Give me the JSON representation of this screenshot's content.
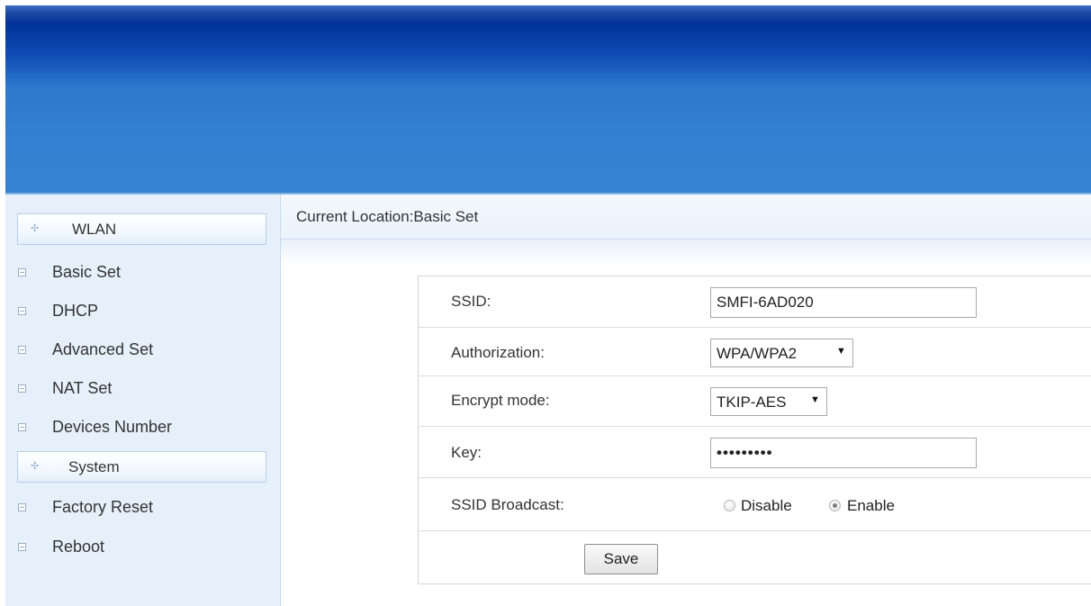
{
  "sidebar": {
    "groups": [
      {
        "label": "WLAN",
        "icon": "expand-icon"
      },
      {
        "label": "System",
        "icon": "expand-icon"
      }
    ],
    "wlan_items": [
      {
        "label": "Basic Set"
      },
      {
        "label": "DHCP"
      },
      {
        "label": "Advanced Set"
      },
      {
        "label": "NAT Set"
      },
      {
        "label": "Devices Number"
      }
    ],
    "system_items": [
      {
        "label": "Factory Reset"
      },
      {
        "label": "Reboot"
      }
    ]
  },
  "location": {
    "text": "Current Location:Basic Set"
  },
  "form": {
    "ssid": {
      "label": "SSID:",
      "value": "SMFI-6AD020"
    },
    "authorization": {
      "label": "Authorization:",
      "value": "WPA/WPA2"
    },
    "encrypt_mode": {
      "label": "Encrypt mode:",
      "value": "TKIP-AES"
    },
    "key": {
      "label": "Key:",
      "value": "•••••••••"
    },
    "ssid_broadcast": {
      "label": "SSID Broadcast:",
      "options": [
        {
          "label": "Disable",
          "checked": false
        },
        {
          "label": "Enable",
          "checked": true
        }
      ]
    },
    "save_label": "Save"
  },
  "colors": {
    "header_top": "#003399",
    "header_bottom": "#3583d3",
    "sidebar_bg": "#e6f0fa"
  }
}
